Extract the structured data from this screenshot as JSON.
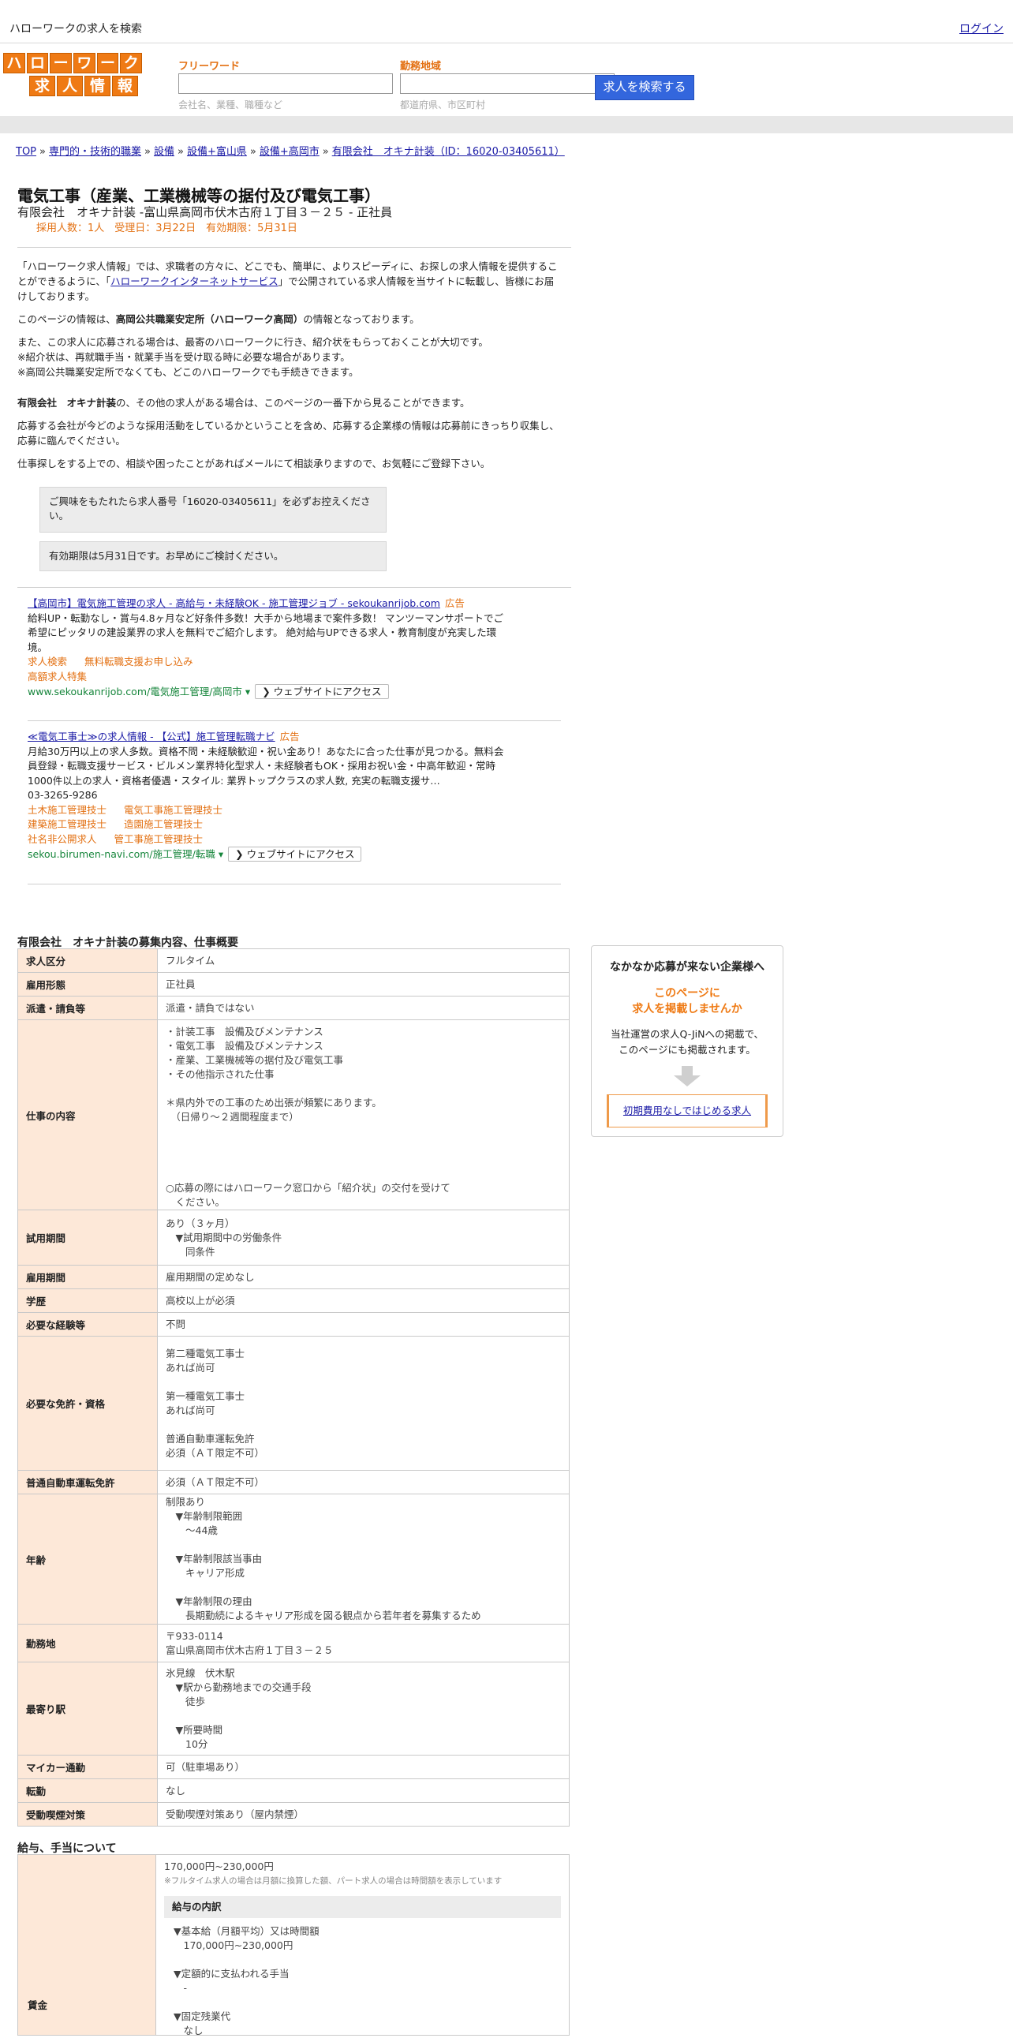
{
  "topbar": {
    "site_title": "ハローワークの求人を検索",
    "login": "ログイン"
  },
  "logo": {
    "row1": [
      "ハ",
      "ロ",
      "ー",
      "ワ",
      "ー",
      "ク"
    ],
    "row2": [
      "求",
      "人",
      "情",
      "報"
    ]
  },
  "search": {
    "freeword_label": "フリーワード",
    "freeword_hint": "会社名、業種、職種など",
    "area_label": "勤務地域",
    "area_hint": "都道府県、市区町村",
    "button": "求人を検索する"
  },
  "breadcrumb": [
    "TOP",
    "専門的・技術的職業",
    "設備",
    "設備+富山県",
    "設備+高岡市",
    "有限会社　オキナ計装（ID：16020-03405611）"
  ],
  "job": {
    "title": "電気工事（産業、工業機械等の据付及び電気工事）",
    "company_line": "有限会社　オキナ計装 -富山県高岡市伏木古府１丁目３－２５ - 正社員",
    "meta": "採用人数：1人　受理日：3月22日　有効期限：5月31日"
  },
  "intro": {
    "p1a": "「ハローワーク求人情報」では、求職者の方々に、どこでも、簡単に、よりスピーディに、お探しの求人情報を提供することができるように、「",
    "p1link": "ハローワークインターネットサービス",
    "p1b": "」で公開されている求人情報を当サイトに転載し、皆様にお届けしております。",
    "p2a": "このページの情報は、",
    "p2b": "高岡公共職業安定所（ハローワーク高岡）",
    "p2c": "の情報となっております。",
    "p3_1": "また、この求人に応募される場合は、最寄のハローワークに行き、紹介状をもらっておくことが大切です。",
    "p3_2": "※紹介状は、再就職手当・就業手当を受け取る時に必要な場合があります。",
    "p3_3": "※高岡公共職業安定所でなくても、どこのハローワークでも手続きできます。",
    "p4a": "有限会社　オキナ計装",
    "p4b": "の、その他の求人がある場合は、このページの一番下から見ることができます。",
    "p5": "応募する会社が今どのような採用活動をしているかということを含め、応募する企業様の情報は応募前にきっちり収集し、応募に臨んでください。",
    "p6": "仕事探しをする上での、相談や困ったことがあればメールにて相談承りますので、お気軽にご登録下さい。"
  },
  "notes": {
    "box1": "ご興味をもたれたら求人番号「16020-03405611」を必ずお控えください。",
    "box2": "有効期限は5月31日です。お早めにご検討ください。"
  },
  "ads": [
    {
      "headline": "【高岡市】電気施工管理の求人 - 高給与・未経験OK - 施工管理ジョブ - sekoukanrijob.com",
      "tag": "広告",
      "desc": "給料UP・転勤なし・賞与4.8ヶ月など好条件多数！大手から地場まで案件多数！ マンツーマンサポートでご希望にピッタリの建設業界の求人を無料でご紹介します。 絶対給与UPできる求人・教育制度が充実した環境。",
      "links": [
        [
          "求人検索",
          "無料転職支援お申し込み"
        ],
        [
          "高額求人特集"
        ]
      ],
      "url": "www.sekoukanrijob.com/電気施工管理/高岡市",
      "visit": "ウェブサイトにアクセス"
    },
    {
      "headline": "≪電気工事士≫の求人情報 - 【公式】施工管理転職ナビ",
      "tag": "広告",
      "desc": "月給30万円以上の求人多数。資格不問・未経験歓迎・祝い金あり！あなたに合った仕事が見つかる。無料会員登録・転職支援サービス・ビルメン業界特化型求人・未経験者もOK・採用お祝い金・中高年歓迎・常時1000件以上の求人・資格者優遇・スタイル: 業界トップクラスの求人数, 充実の転職支援サ…",
      "phone": "03-3265-9286",
      "links": [
        [
          "土木施工管理技士",
          "電気工事施工管理技士"
        ],
        [
          "建築施工管理技士",
          "造園施工管理技士"
        ],
        [
          "社名非公開求人",
          "管工事施工管理技士"
        ]
      ],
      "url": "sekou.birumen-navi.com/施工管理/転職",
      "visit": "ウェブサイトにアクセス"
    }
  ],
  "section1_title": "有限会社　オキナ計装の募集内容、仕事概要",
  "table": [
    {
      "k": "求人区分",
      "v": "フルタイム"
    },
    {
      "k": "雇用形態",
      "v": "正社員"
    },
    {
      "k": "派遣・請負等",
      "v": "派遣・請負ではない"
    },
    {
      "k": "仕事の内容",
      "v": "・計装工事　設備及びメンテナンス\n・電気工事　設備及びメンテナンス\n・産業、工業機械等の据付及び電気工事\n・その他指示された仕事\n\n＊県内外での工事のため出張が頻繁にあります。\n　（日帰り～２週間程度まで）\n\n\n\n\n○応募の際にはハローワーク窓口から「紹介状」の交付を受けて\n　ください。"
    },
    {
      "k": "試用期間",
      "v": "あり（３ヶ月）\n　▼試用期間中の労働条件\n　　同条件"
    },
    {
      "k": "雇用期間",
      "v": "雇用期間の定めなし"
    },
    {
      "k": "学歴",
      "v": "高校以上が必須"
    },
    {
      "k": "必要な経験等",
      "v": "不問"
    },
    {
      "k": "必要な免許・資格",
      "v": "第二種電気工事士\nあれば尚可\n\n第一種電気工事士\nあれば尚可\n\n普通自動車運転免許\n必須（ＡＴ限定不可）"
    },
    {
      "k": "普通自動車運転免許",
      "v": "必須（ＡＴ限定不可）"
    },
    {
      "k": "年齢",
      "v": "制限あり\n　▼年齢制限範囲\n　　～44歳\n\n　▼年齢制限該当事由\n　　キャリア形成\n\n　▼年齢制限の理由\n　　長期勤続によるキャリア形成を図る観点から若年者を募集するため"
    },
    {
      "k": "勤務地",
      "v": "〒933-0114\n富山県高岡市伏木古府１丁目３－２５"
    },
    {
      "k": "最寄り駅",
      "v": "氷見線　伏木駅\n　▼駅から勤務地までの交通手段\n　　徒歩\n\n　▼所要時間\n　　10分"
    },
    {
      "k": "マイカー通勤",
      "v": "可（駐車場あり）"
    },
    {
      "k": "転勤",
      "v": "なし"
    },
    {
      "k": "受動喫煙対策",
      "v": "受動喫煙対策あり（屋内禁煙）"
    }
  ],
  "side": {
    "t1": "なかなか応募が来ない企業様へ",
    "t2a": "このページに",
    "t2b": "求人を掲載しませんか",
    "t3a": "当社運営の求人Q-JiNへの掲載で、",
    "t3b": "このページにも掲載されます。",
    "btn": "初期費用なしではじめる求人"
  },
  "section2_title": "給与、手当について",
  "salary": {
    "label": "賃金",
    "range": "170,000円~230,000円",
    "note": "※フルタイム求人の場合は月額に換算した額、パート求人の場合は時間額を表示しています",
    "inner_title": "給与の内訳",
    "lines": "▼基本給（月額平均）又は時間額\n　170,000円~230,000円\n\n▼定額的に支払われる手当\n　-\n\n▼固定残業代\n　なし"
  }
}
